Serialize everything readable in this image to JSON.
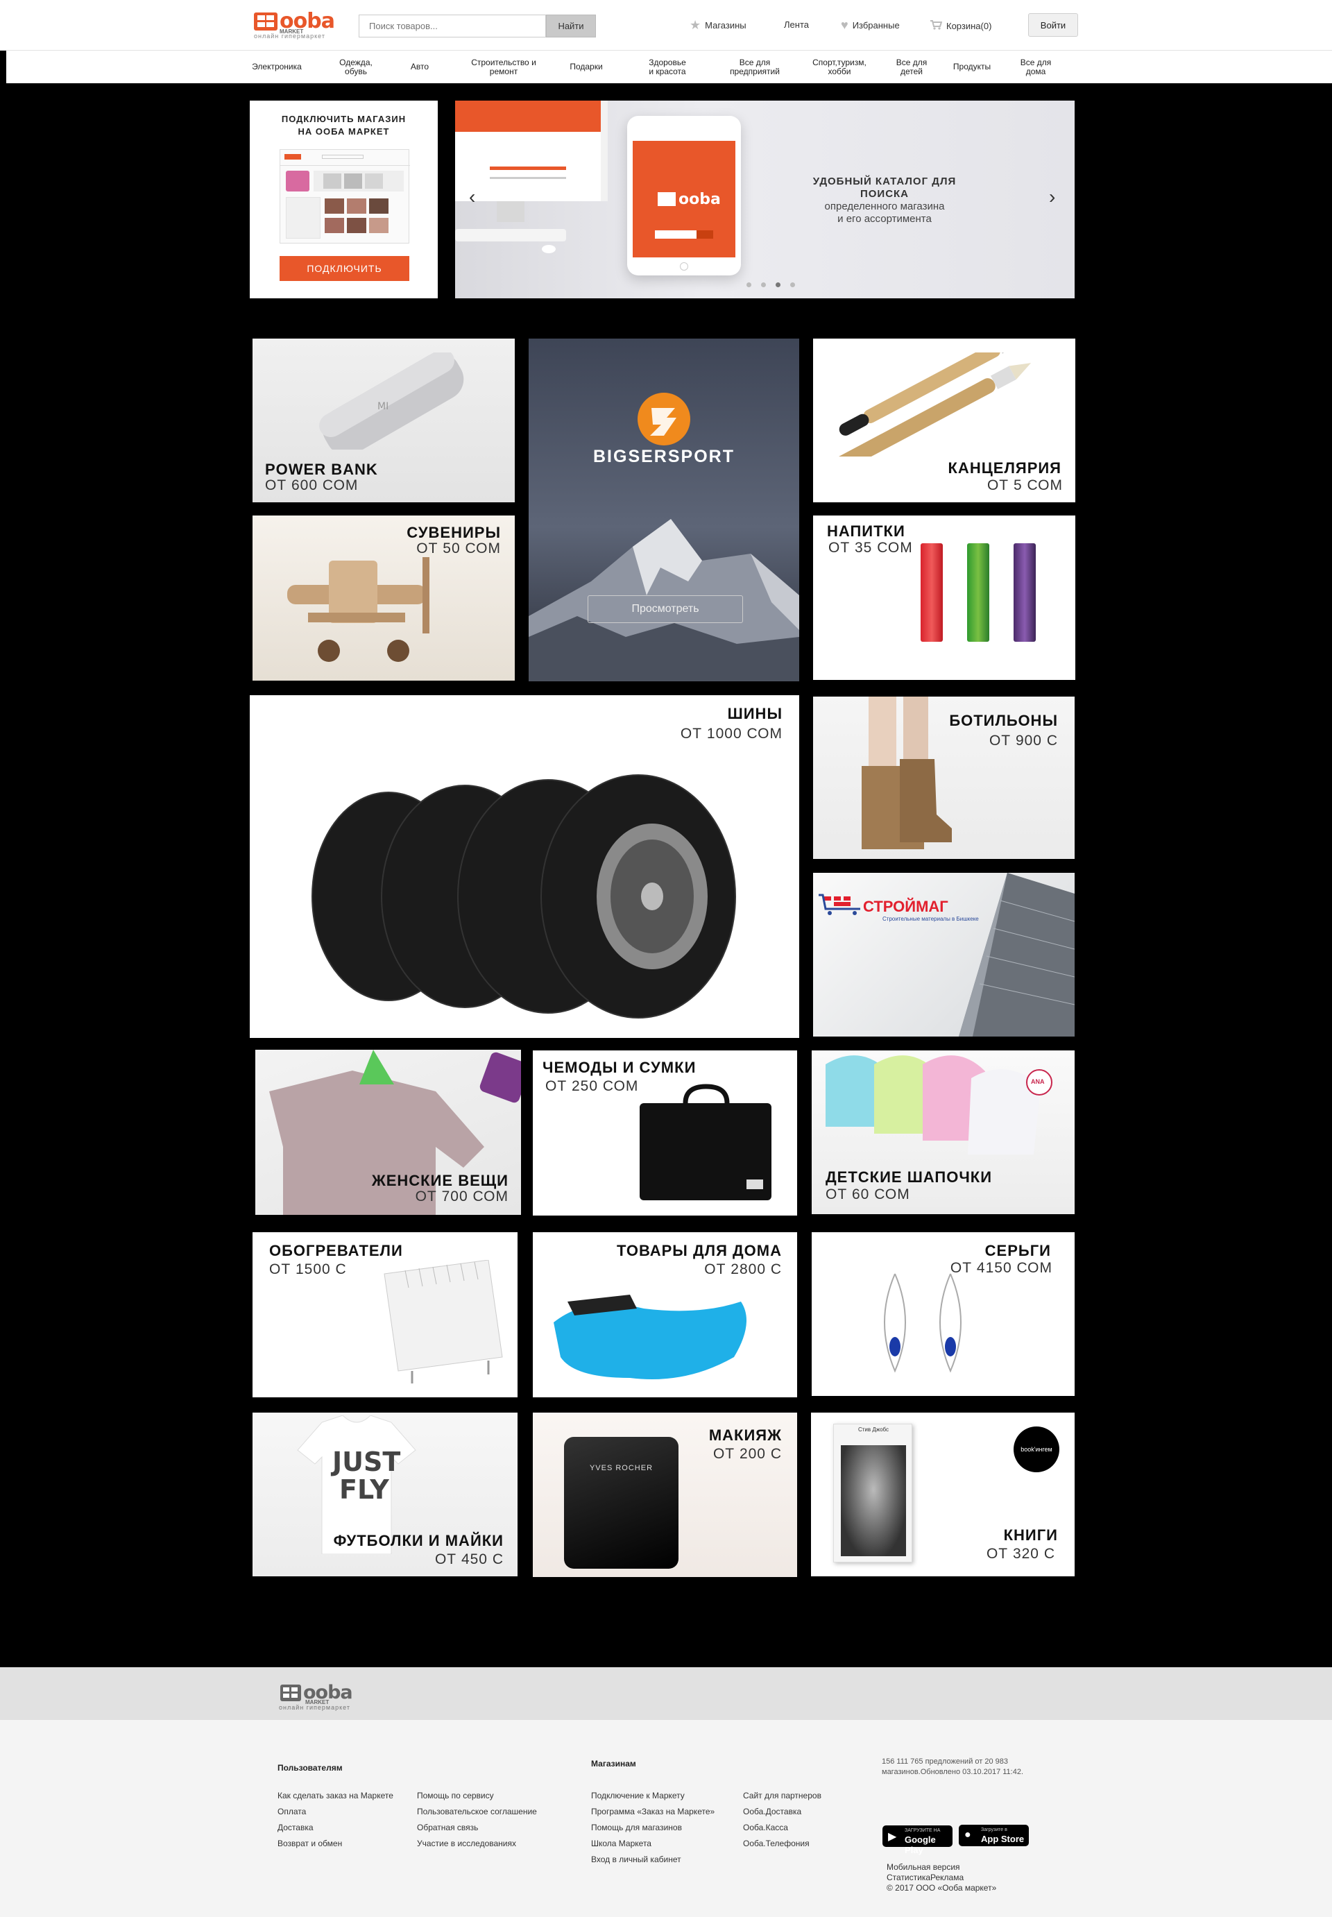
{
  "header": {
    "logo_word": "ooba",
    "logo_sub": "MARKET",
    "logo_tag": "онлайн гипермаркет",
    "search": {
      "placeholder": "Поиск товаров...",
      "button": "Найти"
    },
    "links": {
      "stores": "Магазины",
      "feed": "Лента",
      "favorites": "Избранные",
      "cart": "Корзина(0)"
    },
    "login": "Войти"
  },
  "categories": [
    "Электроника",
    "Одежда,\nобувь",
    "Авто",
    "Строительство и\nремонт",
    "Подарки",
    "Здоровье\nи красота",
    "Все для\nпредприятий",
    "Спорт,туризм,\nхобби",
    "Все для\nдетей",
    "Продукты",
    "Все для\nдома"
  ],
  "promo": {
    "connect_title": "ПОДКЛЮЧИТЬ МАГАЗИН\nНА ООБА МАРКЕТ",
    "connect_button": "ПОДКЛЮЧИТЬ",
    "slide_line1": "УДОБНЫЙ КАТАЛОГ ДЛЯ ПОИСКА",
    "slide_line2": "определенного магазина",
    "slide_line3": "и его ассортимента",
    "slide_count": 4,
    "slide_active": 3
  },
  "tiles": {
    "powerbank": {
      "title": "POWER BANK",
      "price": "ОТ 600 СОМ"
    },
    "stationery": {
      "title": "КАНЦЕЛЯРИЯ",
      "price": "ОТ 5 СОМ"
    },
    "souvenirs": {
      "title": "СУВЕНИРЫ",
      "price": "ОТ 50 СОМ"
    },
    "bigser": {
      "brand": "BIGSERSPORT",
      "button": "Просмотреть"
    },
    "drinks": {
      "title": "НАПИТКИ",
      "price": "ОТ 35 СОМ"
    },
    "tires": {
      "title": "ШИНЫ",
      "price": "ОТ 1000 СОМ"
    },
    "boots": {
      "title": "БОТИЛЬОНЫ",
      "price": "ОТ 900 С"
    },
    "stroimag": {
      "brand": "СТРОЙМАГ",
      "tagline": "Строительные материалы в Бишкеке"
    },
    "women": {
      "title": "ЖЕНСКИЕ ВЕЩИ",
      "price": "ОТ 700 СОМ"
    },
    "bags": {
      "title": "ЧЕМОДЫ И СУМКИ",
      "price": "ОТ 250 СОМ"
    },
    "hats": {
      "title": "ДЕТСКИЕ ШАПОЧКИ",
      "price": "ОТ 60 СОМ",
      "badge": "ANA"
    },
    "heaters": {
      "title": "ОБОГРЕВАТЕЛИ",
      "price": "ОТ 1500 С"
    },
    "home": {
      "title": "ТОВАРЫ ДЛЯ ДОМА",
      "price": "ОТ 2800 С"
    },
    "earrings": {
      "title": "СЕРЬГИ",
      "price": "ОТ 4150 СОМ"
    },
    "tshirts": {
      "title": "ФУТБОЛКИ И МАЙКИ",
      "price": "ОТ 450 С",
      "print": "JUST\nFLY"
    },
    "makeup": {
      "title": "МАКИЯЖ",
      "price": "ОТ 200 С",
      "brand": "YVES ROCHER"
    },
    "books": {
      "title": "КНИГИ",
      "price": "ОТ 320 С",
      "badge": "book'ингем",
      "cover_title": "Стив Джобс"
    }
  },
  "footer": {
    "users_head": "Пользователям",
    "users_col1": [
      "Как сделать заказ на Маркете",
      "Оплата",
      "Доставка",
      "Возврат и обмен"
    ],
    "users_col2": [
      "Помощь по сервису",
      "Пользовательское соглашение",
      "Обратная связь",
      "Участие в исследованиях"
    ],
    "stores_head": "Магазинам",
    "stores_col1": [
      "Подключение к Маркету",
      "Программа «Заказ на Маркете»",
      "Помощь для магазинов",
      "Школа Маркета",
      "Вход в личный кабинет"
    ],
    "stores_col2": [
      "Сайт для партнеров",
      "Ооба.Доставка",
      "Ооба.Касса",
      "Ооба.Телефония"
    ],
    "stats": "156 111 765 предложений от 20 983 магазинов.Обновлено 03.10.2017 11:42.",
    "google_small": "ЗАГРУЗИТЕ НА",
    "google_big": "Google Play",
    "apple_small": "Загрузите в",
    "apple_big": "App Store",
    "mobile": "Мобильная версия",
    "stats_ads": "СтатистикаРеклама",
    "copyright": "© 2017  ООО «Ооба маркет»"
  }
}
